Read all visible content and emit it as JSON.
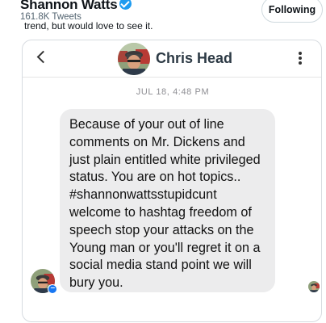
{
  "profile": {
    "name": "Shannon Watts",
    "tweet_count": "161.8K Tweets",
    "follow_label": "Following",
    "verified_icon": "verified-badge-icon"
  },
  "tweet": {
    "text_fragment": "trend, but would love to see it."
  },
  "chat": {
    "contact_name": "Chris Head",
    "timestamp": "JUL 18, 4:48 PM",
    "message": "Because of your out of line\ncomments on Mr. Dickens and\njust plain entitled white privileged\nstatus. You are on hot topics..\n#shannonwattsstupidcunt\nwelcome to hashtag freedom of\nspeech stop your attacks on the\nYoung man or you'll regret it on a\nsocial media stand point we will\nbury you.",
    "icons": {
      "back": "chevron-left-icon",
      "more": "more-vertical-icon",
      "badge": "messenger-icon"
    }
  },
  "colors": {
    "verified": "#1d9bf0",
    "bubble": "#ececed",
    "messenger": "#1877f2"
  }
}
